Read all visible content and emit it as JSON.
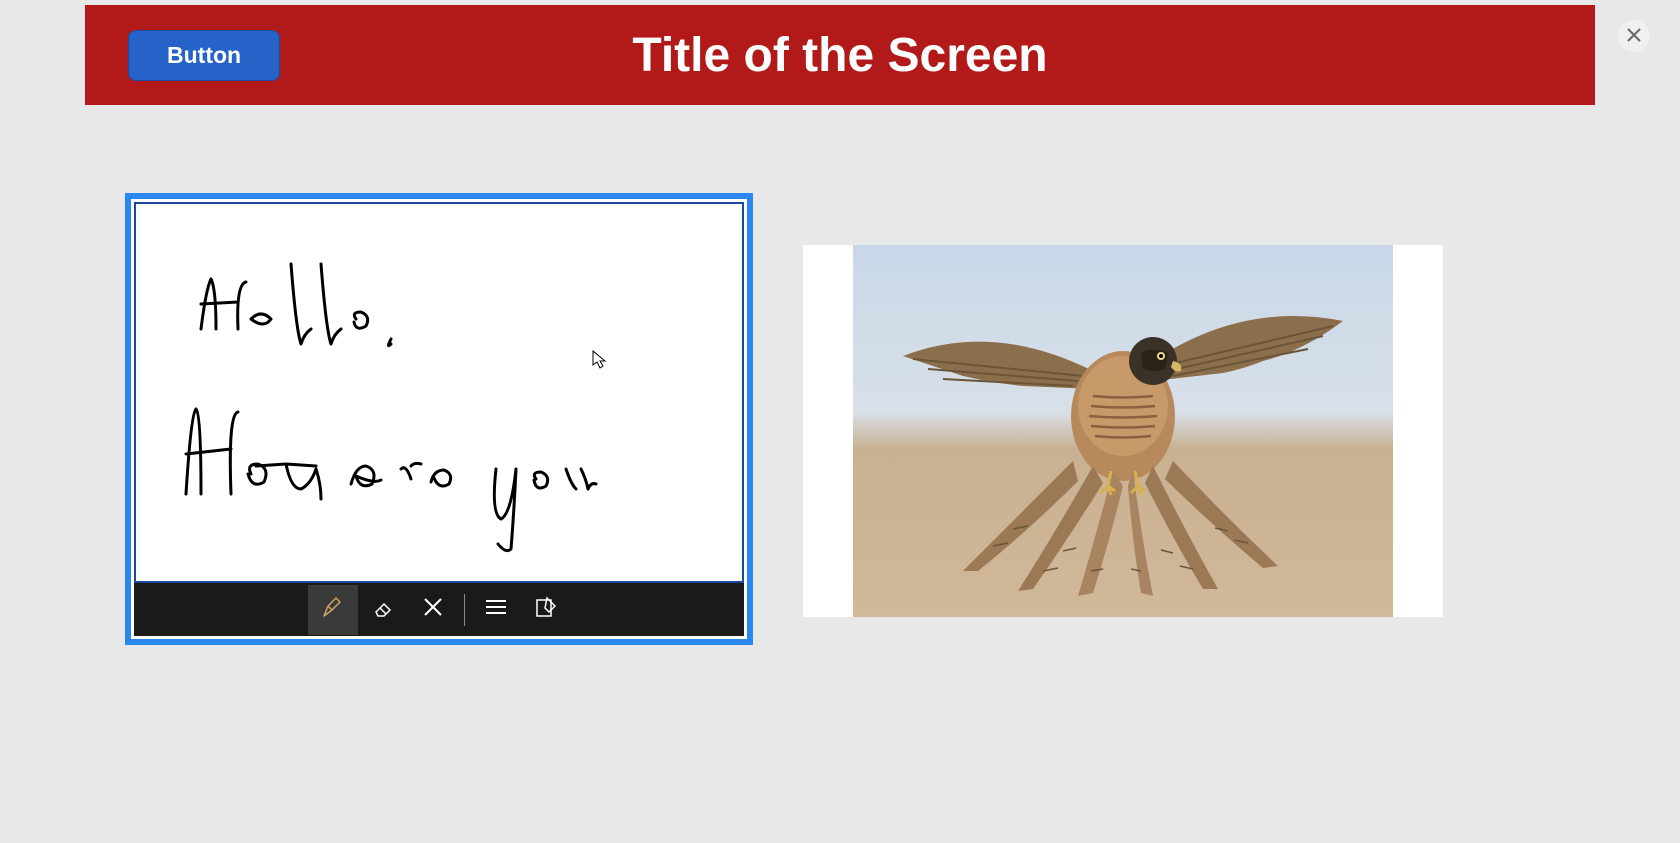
{
  "header": {
    "button_label": "Button",
    "title": "Title of the Screen"
  },
  "signature": {
    "handwriting_line1": "Hello,",
    "handwriting_line2": "How are you",
    "toolbar": {
      "pen_icon": "pen-icon",
      "eraser_icon": "eraser-icon",
      "clear_icon": "clear-icon",
      "lines_icon": "lines-icon",
      "edit_icon": "edit-icon"
    }
  },
  "image": {
    "alt": "Falcon bird in flight"
  },
  "close_label": "Close"
}
